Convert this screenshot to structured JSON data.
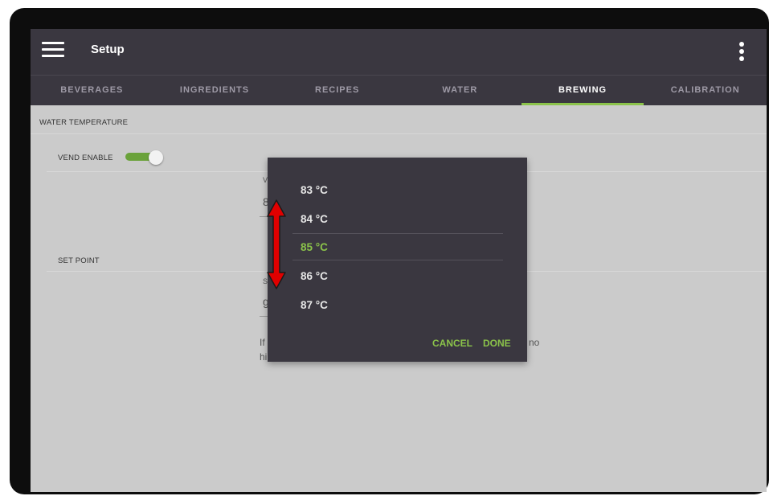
{
  "appbar": {
    "title": "Setup",
    "menu_icon": "hamburger-menu-icon",
    "overflow_icon": "more-vert-icon"
  },
  "tabs": [
    {
      "label": "BEVERAGES",
      "active": false
    },
    {
      "label": "INGREDIENTS",
      "active": false
    },
    {
      "label": "RECIPES",
      "active": false
    },
    {
      "label": "WATER",
      "active": false
    },
    {
      "label": "BREWING",
      "active": true
    },
    {
      "label": "CALIBRATION",
      "active": false
    }
  ],
  "content": {
    "water_temperature_label": "WATER TEMPERATURE",
    "vend_enable_label": "VEND ENABLE",
    "vend_enable_on": true,
    "set_point_label": "SET POINT",
    "fragments": {
      "v1": "V",
      "v2": "8",
      "s1": "S",
      "s2": "g",
      "if": "If",
      "hi": "hi",
      "no": "no"
    }
  },
  "dialog": {
    "options": [
      "83 °C",
      "84 °C",
      "85 °C",
      "86 °C",
      "87 °C"
    ],
    "selected_index": 2,
    "cancel_label": "CANCEL",
    "done_label": "DONE"
  },
  "colors": {
    "appbar": "#3a3740",
    "accent": "#8bc34a",
    "screen_bg": "#cbcbcb",
    "arrow": "#e00000"
  }
}
